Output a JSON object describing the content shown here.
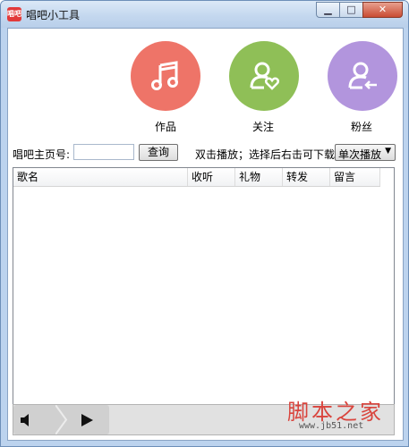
{
  "window": {
    "title": "唱吧小工具",
    "icon_text": "唱吧"
  },
  "categories": [
    {
      "label": "作品",
      "icon": "music-note-icon",
      "color": "#ee7468"
    },
    {
      "label": "关注",
      "icon": "user-heart-icon",
      "color": "#8fbf57"
    },
    {
      "label": "粉丝",
      "icon": "user-back-icon",
      "color": "#b295dd"
    }
  ],
  "search": {
    "label": "唱吧主页号:",
    "value": "",
    "button": "查询"
  },
  "hint": "双击播放；选择后右击可下载",
  "mode_select": {
    "value": "单次播放"
  },
  "table": {
    "columns": [
      "歌名",
      "收听",
      "礼物",
      "转发",
      "留言"
    ],
    "rows": []
  },
  "player": {
    "volume_icon": "speaker-icon",
    "play_icon": "play-icon"
  },
  "watermark": {
    "text": "脚本之家",
    "url": "www.jb51.net"
  }
}
